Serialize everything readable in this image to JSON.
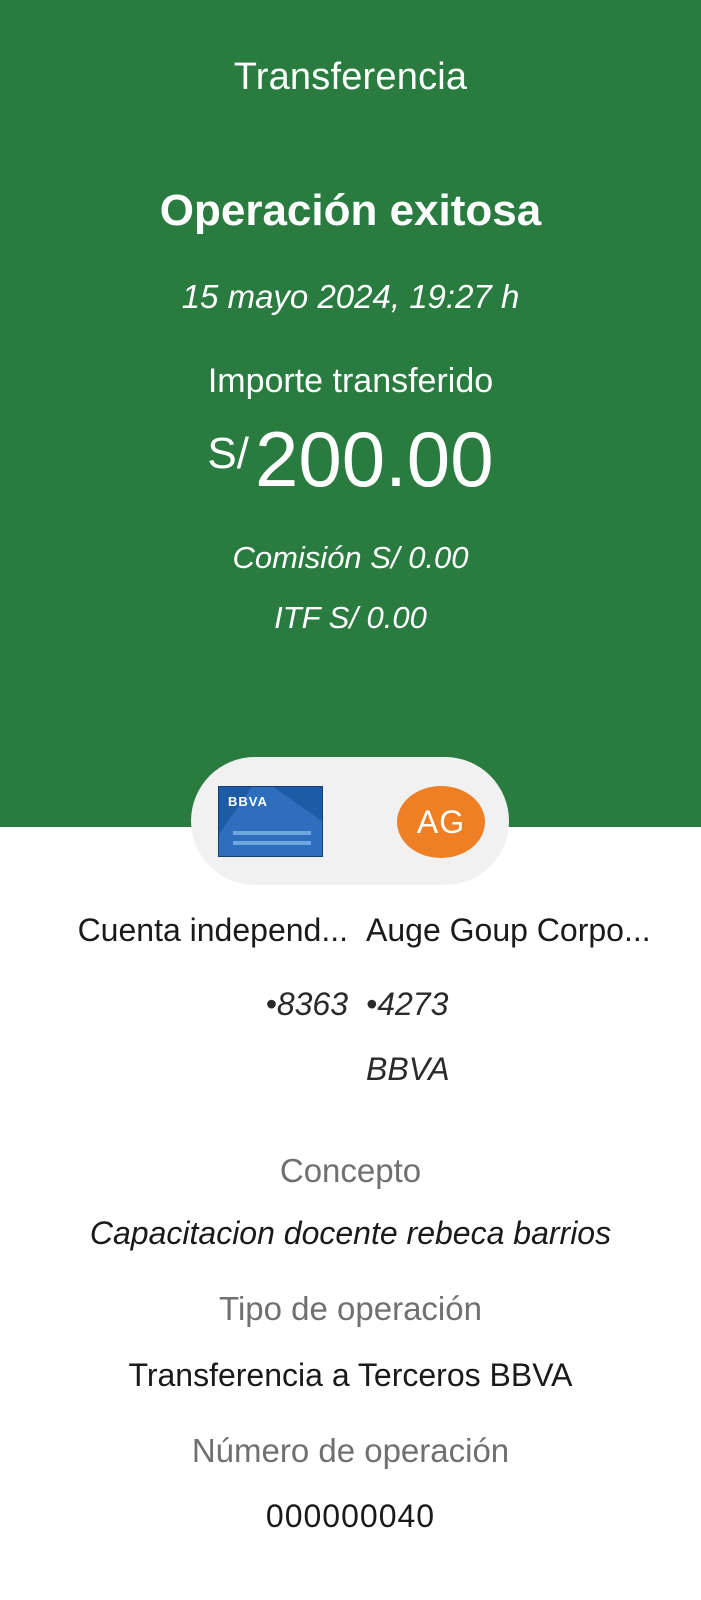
{
  "header": {
    "title": "Transferencia",
    "status": "Operación exitosa",
    "datetime": "15 mayo 2024,  19:27 h"
  },
  "amount": {
    "label": "Importe transferido",
    "currency": "S/",
    "value": "200.00"
  },
  "fees": {
    "commission": "Comisión  S/ 0.00",
    "itf": "ITF  S/ 0.00"
  },
  "logos": {
    "bank_card_brand": "BBVA",
    "recipient_initials": "AG"
  },
  "accounts": {
    "origin": {
      "name": "Cuenta independ...",
      "number": "•8363"
    },
    "destination": {
      "name": "Auge Goup Corpo...",
      "number": "•4273",
      "bank": "BBVA"
    }
  },
  "details": {
    "concept_label": "Concepto",
    "concept_value": "Capacitacion docente rebeca barrios",
    "type_label": "Tipo de operación",
    "type_value": "Transferencia a Terceros BBVA",
    "number_label": "Número de operación",
    "number_value": "000000040"
  },
  "colors": {
    "header_green": "#2a7b3f",
    "avatar_orange": "#ef7f24",
    "bbva_blue": "#1d5ba6"
  }
}
